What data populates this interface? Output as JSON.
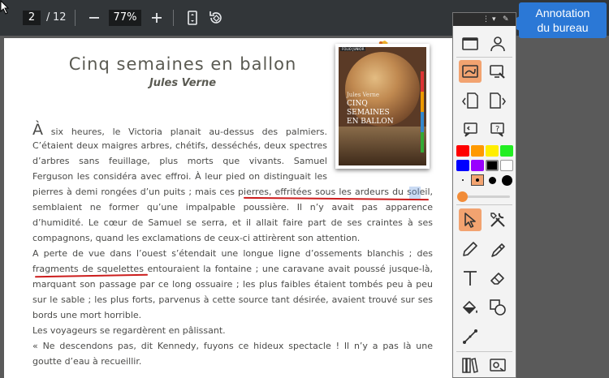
{
  "viewer": {
    "current_page": "2",
    "separator": "/",
    "total_pages": "12",
    "zoom": "77%"
  },
  "document": {
    "title": "Cinq semaines en ballon",
    "author": "Jules Verne",
    "cover": {
      "series_label": "FOLIO JUNIOR",
      "author": "Jules Verne",
      "title_line1": "CINQ SEMAINES",
      "title_line2": "EN BALLON"
    },
    "lines": [
      {
        "dropcap": "À",
        "text": " six heures, le Victoria planait au-dessus des palmiers."
      },
      {
        "text": "C’étaient deux maigres arbres, chétifs, desséchés, deux spectres"
      },
      {
        "text": "d’arbres sans feuillage, plus morts que vivants. Samuel"
      },
      {
        "text": "Ferguson les considéra avec effroi. À leur pied on distinguait les"
      },
      {
        "text": "pierres à demi rongées d’un puits ; mais ces pierres, effritées sous les ardeurs du soleil,"
      },
      {
        "text": "semblaient ne former qu’une impalpable poussière. Il n’y avait pas apparence"
      },
      {
        "text": "d’humidité. Le cœur de Samuel se serra, et il allait faire part de ses craintes à ses"
      },
      {
        "text": "compagnons, quand les exclamations de ceux-ci attirèrent son attention."
      },
      {
        "text": "A perte de vue dans l’ouest s’étendait une longue ligne d’ossements blanchis ; des"
      },
      {
        "text": "fragments de squelettes entouraient la fontaine ; une caravane avait poussé jusque-là,"
      },
      {
        "text": "marquant son passage par ce long ossuaire ; les plus faibles étaient tombés peu à peu"
      },
      {
        "text": "sur le sable ; les plus forts, parvenus à cette source tant désirée, avaient trouvé sur ses"
      },
      {
        "text": "bords une mort horrible."
      },
      {
        "text": "Les voyageurs se regardèrent en pâlissant."
      },
      {
        "text": "« Ne descendons pas, dit Kennedy, fuyons ce hideux spectacle ! Il n’y a pas là une"
      },
      {
        "text": "goutte d’eau à recueillir."
      }
    ]
  },
  "annotation_panel": {
    "callout_line1": "Annotation",
    "callout_line2": "du bureau",
    "colors": [
      "#ff0000",
      "#ff9900",
      "#ffee00",
      "#22ee22",
      "#0000ff",
      "#9900ff",
      "#000000",
      "#ffffff"
    ],
    "active_color": "#000000",
    "accent": "#f2a370",
    "tools": [
      "whiteboard-icon",
      "user-icon",
      "desktop-annotation-icon",
      "desktop-settings-icon",
      "previous-page-icon",
      "next-page-icon",
      "previous-help-icon",
      "next-help-icon",
      "select-arrow-icon",
      "tools-icon",
      "pencil-icon",
      "highlighter-icon",
      "text-icon",
      "eraser-icon",
      "fill-icon",
      "shapes-icon",
      "line-icon",
      "library-icon",
      "screen-capture-icon"
    ]
  }
}
